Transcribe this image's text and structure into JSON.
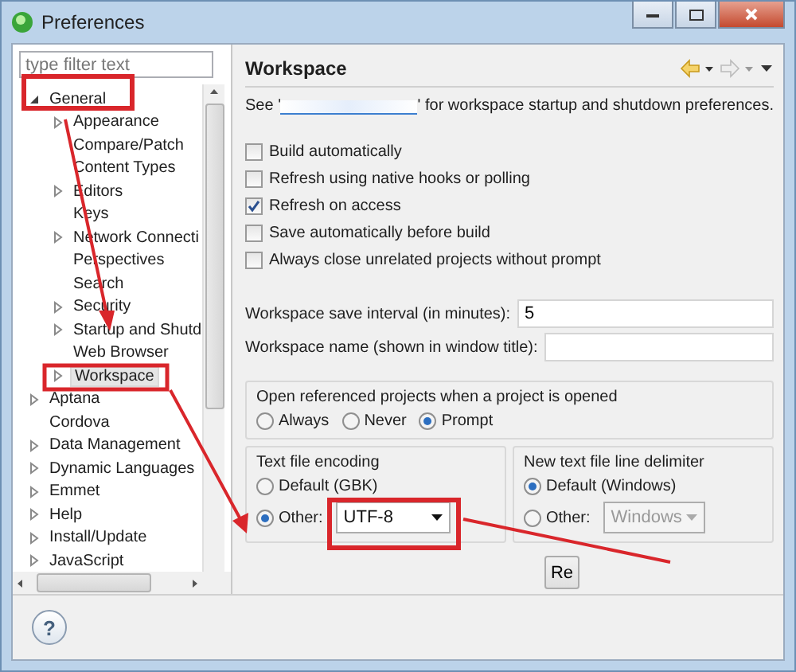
{
  "window": {
    "title": "Preferences"
  },
  "filter": {
    "placeholder": "type filter text"
  },
  "tree": [
    {
      "label": "General",
      "expanded": true,
      "selected": false,
      "children": [
        {
          "label": "Appearance",
          "expanded": false,
          "selected": false
        },
        {
          "label": "Compare/Patch",
          "selected": false
        },
        {
          "label": "Content Types",
          "selected": false
        },
        {
          "label": "Editors",
          "expanded": false,
          "selected": false
        },
        {
          "label": "Keys",
          "selected": false
        },
        {
          "label": "Network Connecti",
          "expanded": false,
          "selected": false
        },
        {
          "label": "Perspectives",
          "selected": false
        },
        {
          "label": "Search",
          "selected": false
        },
        {
          "label": "Security",
          "expanded": false,
          "selected": false
        },
        {
          "label": "Startup and Shutd",
          "expanded": false,
          "selected": false
        },
        {
          "label": "Web Browser",
          "selected": false
        },
        {
          "label": "Workspace",
          "expanded": false,
          "selected": true
        }
      ]
    },
    {
      "label": "Aptana",
      "expanded": false,
      "selected": false
    },
    {
      "label": "Cordova",
      "selected": false
    },
    {
      "label": "Data Management",
      "expanded": false,
      "selected": false
    },
    {
      "label": "Dynamic Languages",
      "expanded": false,
      "selected": false
    },
    {
      "label": "Emmet",
      "expanded": false,
      "selected": false
    },
    {
      "label": "Help",
      "expanded": false,
      "selected": false
    },
    {
      "label": "Install/Update",
      "expanded": false,
      "selected": false
    },
    {
      "label": "JavaScript",
      "expanded": false,
      "selected": false
    }
  ],
  "page": {
    "title": "Workspace",
    "intro_before": "See '",
    "intro_after": "' for workspace startup and shutdown preferences.",
    "checkboxes": [
      {
        "label": "Build automatically",
        "checked": false
      },
      {
        "label": "Refresh using native hooks or polling",
        "checked": false
      },
      {
        "label": "Refresh on access",
        "checked": true
      },
      {
        "label": "Save automatically before build",
        "checked": false
      },
      {
        "label": "Always close unrelated projects without prompt",
        "checked": false
      }
    ],
    "fields": [
      {
        "label": "Workspace save interval (in minutes):",
        "value": "5"
      },
      {
        "label": "Workspace name (shown in window title):"
      }
    ],
    "open_projects": {
      "title": "Open referenced projects when a project is opened",
      "options": [
        {
          "label": "Always",
          "selected": false
        },
        {
          "label": "Never",
          "selected": false
        },
        {
          "label": "Prompt",
          "selected": true
        }
      ]
    },
    "encoding": {
      "title": "Text file encoding",
      "options": [
        {
          "label": "Default (GBK)",
          "selected": false
        },
        {
          "label": "Other:",
          "selected": true
        }
      ],
      "combo": {
        "value": "UTF-8",
        "disabled": false
      }
    },
    "delimiter": {
      "title": "New text file line delimiter",
      "options": [
        {
          "label": "Default (Windows)",
          "selected": true
        },
        {
          "label": "Other:",
          "selected": false
        }
      ],
      "combo": {
        "value": "Windows",
        "disabled": true
      }
    },
    "button": "Re"
  },
  "footer": {
    "help": "?"
  }
}
